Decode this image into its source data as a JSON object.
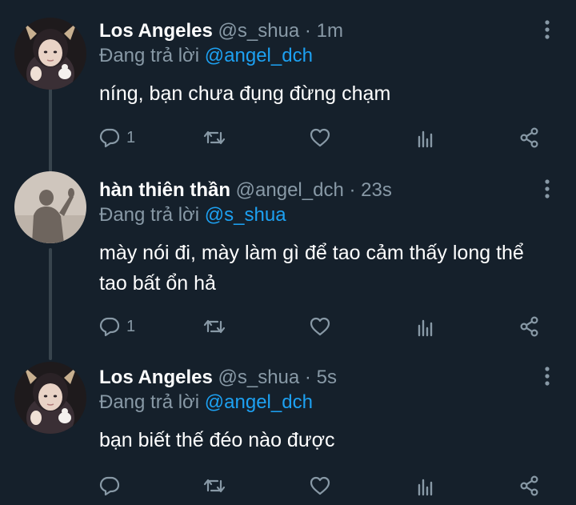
{
  "colors": {
    "background": "#15202b",
    "primary_text": "#ffffff",
    "secondary_text": "#8899a6",
    "accent": "#1da1f2",
    "thread_line": "#38444d"
  },
  "icons": {
    "more": "more-vertical-icon",
    "reply": "comment-icon",
    "retweet": "retweet-icon",
    "like": "heart-icon",
    "analytics": "bar-chart-icon",
    "share": "share-icon"
  },
  "tweets": [
    {
      "name": "Los Angeles",
      "handle": "@s_shua",
      "separator": "·",
      "time": "1m",
      "replying_prefix": "Đang trả lời",
      "replying_to": "@angel_dch",
      "text": "níng, bạn chưa đụng đừng chạm",
      "reply_count": "1"
    },
    {
      "name": "hàn thiên thần",
      "handle": "@angel_dch",
      "separator": "·",
      "time": "23s",
      "replying_prefix": "Đang trả lời",
      "replying_to": "@s_shua",
      "text": "mày nói đi, mày làm gì để tao cảm thấy long thể tao bất ổn hả",
      "reply_count": "1"
    },
    {
      "name": "Los Angeles",
      "handle": "@s_shua",
      "separator": "·",
      "time": "5s",
      "replying_prefix": "Đang trả lời",
      "replying_to": "@angel_dch",
      "text": "bạn biết thế đéo nào được",
      "reply_count": ""
    }
  ]
}
